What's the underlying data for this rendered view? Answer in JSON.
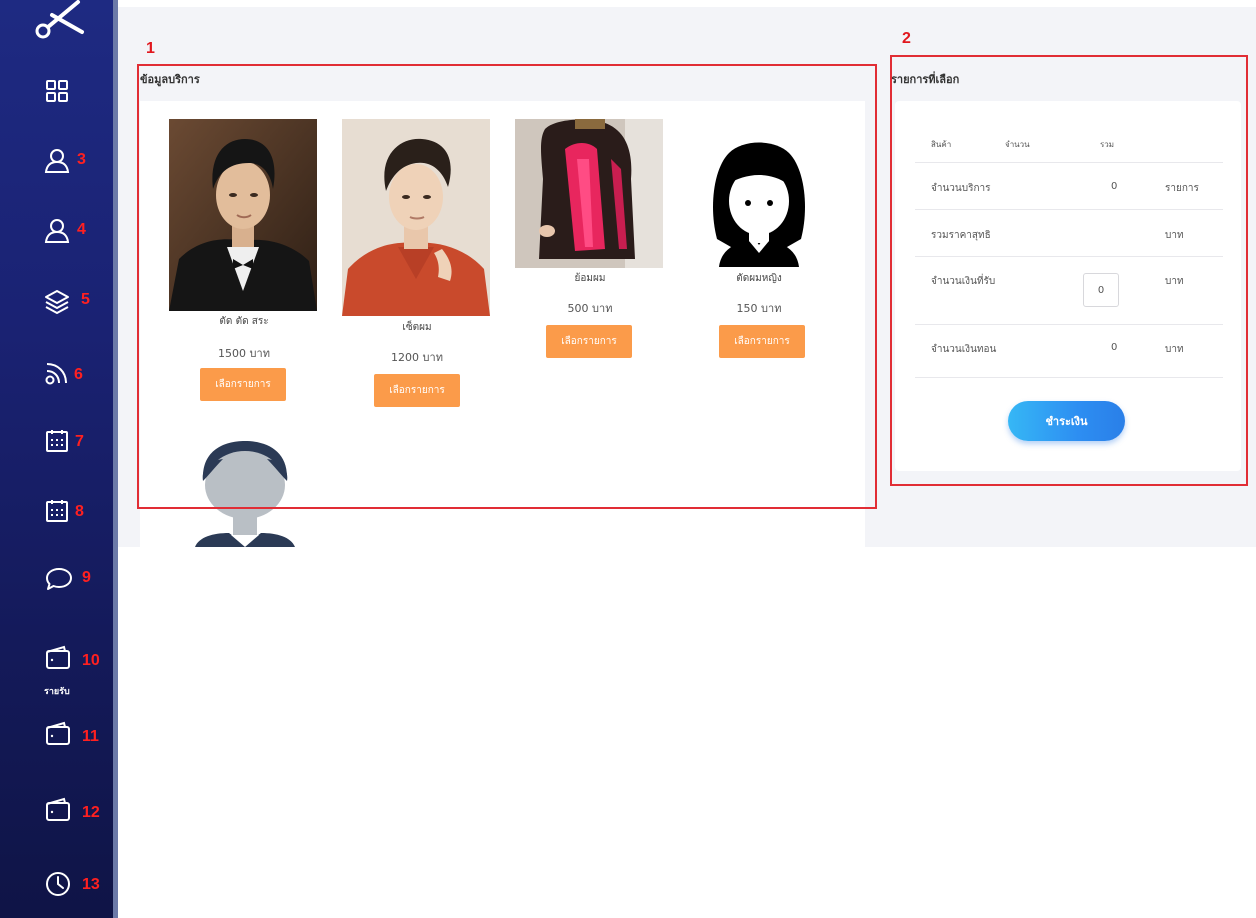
{
  "sidebar": {
    "items": [
      {
        "icon": "grid-icon",
        "number": ""
      },
      {
        "icon": "user-icon",
        "number": "3"
      },
      {
        "icon": "user-icon",
        "number": "4"
      },
      {
        "icon": "layers-icon",
        "number": "5"
      },
      {
        "icon": "rss-icon",
        "number": "6"
      },
      {
        "icon": "calendar-icon",
        "number": "7"
      },
      {
        "icon": "calendar-icon",
        "number": "8"
      },
      {
        "icon": "chat-icon",
        "number": "9"
      },
      {
        "icon": "wallet-icon",
        "number": "10",
        "caption": "รายรับ"
      },
      {
        "icon": "wallet-icon",
        "number": "11"
      },
      {
        "icon": "wallet-icon",
        "number": "12"
      },
      {
        "icon": "clock-icon",
        "number": "13"
      }
    ]
  },
  "regions": {
    "services_number": "1",
    "cart_number": "2"
  },
  "services": {
    "title": "ข้อมูลบริการ",
    "items": [
      {
        "name": "ตัด ตัด สระ",
        "price": "1500 บาท",
        "button": "เลือกรายการ"
      },
      {
        "name": "เซ็ตผม",
        "price": "1200 บาท",
        "button": "เลือกรายการ"
      },
      {
        "name": "ย้อมผม",
        "price": "500 บาท",
        "button": "เลือกรายการ"
      },
      {
        "name": "ตัดผมหญิง",
        "price": "150 บาท",
        "button": "เลือกรายการ"
      }
    ]
  },
  "cart": {
    "title": "รายการที่เลือก",
    "headers": {
      "product": "สินค้า",
      "qty": "จำนวน",
      "total": "รวม"
    },
    "rows": {
      "service_count": {
        "label": "จำนวนบริการ",
        "value": "0",
        "unit": "รายการ"
      },
      "net_price": {
        "label": "รวมราคาสุทธิ",
        "value": "",
        "unit": "บาท"
      },
      "received": {
        "label": "จำนวนเงินที่รับ",
        "value": "0",
        "unit": "บาท"
      },
      "change": {
        "label": "จำนวนเงินทอน",
        "value": "0",
        "unit": "บาท"
      }
    },
    "pay_button": "ชำระเงิน"
  },
  "colors": {
    "sidebar": "#1a2273",
    "accent_orange": "#fb9b4a",
    "highlight_red": "#e12d35",
    "pay_blue": "#2d8ef2"
  }
}
